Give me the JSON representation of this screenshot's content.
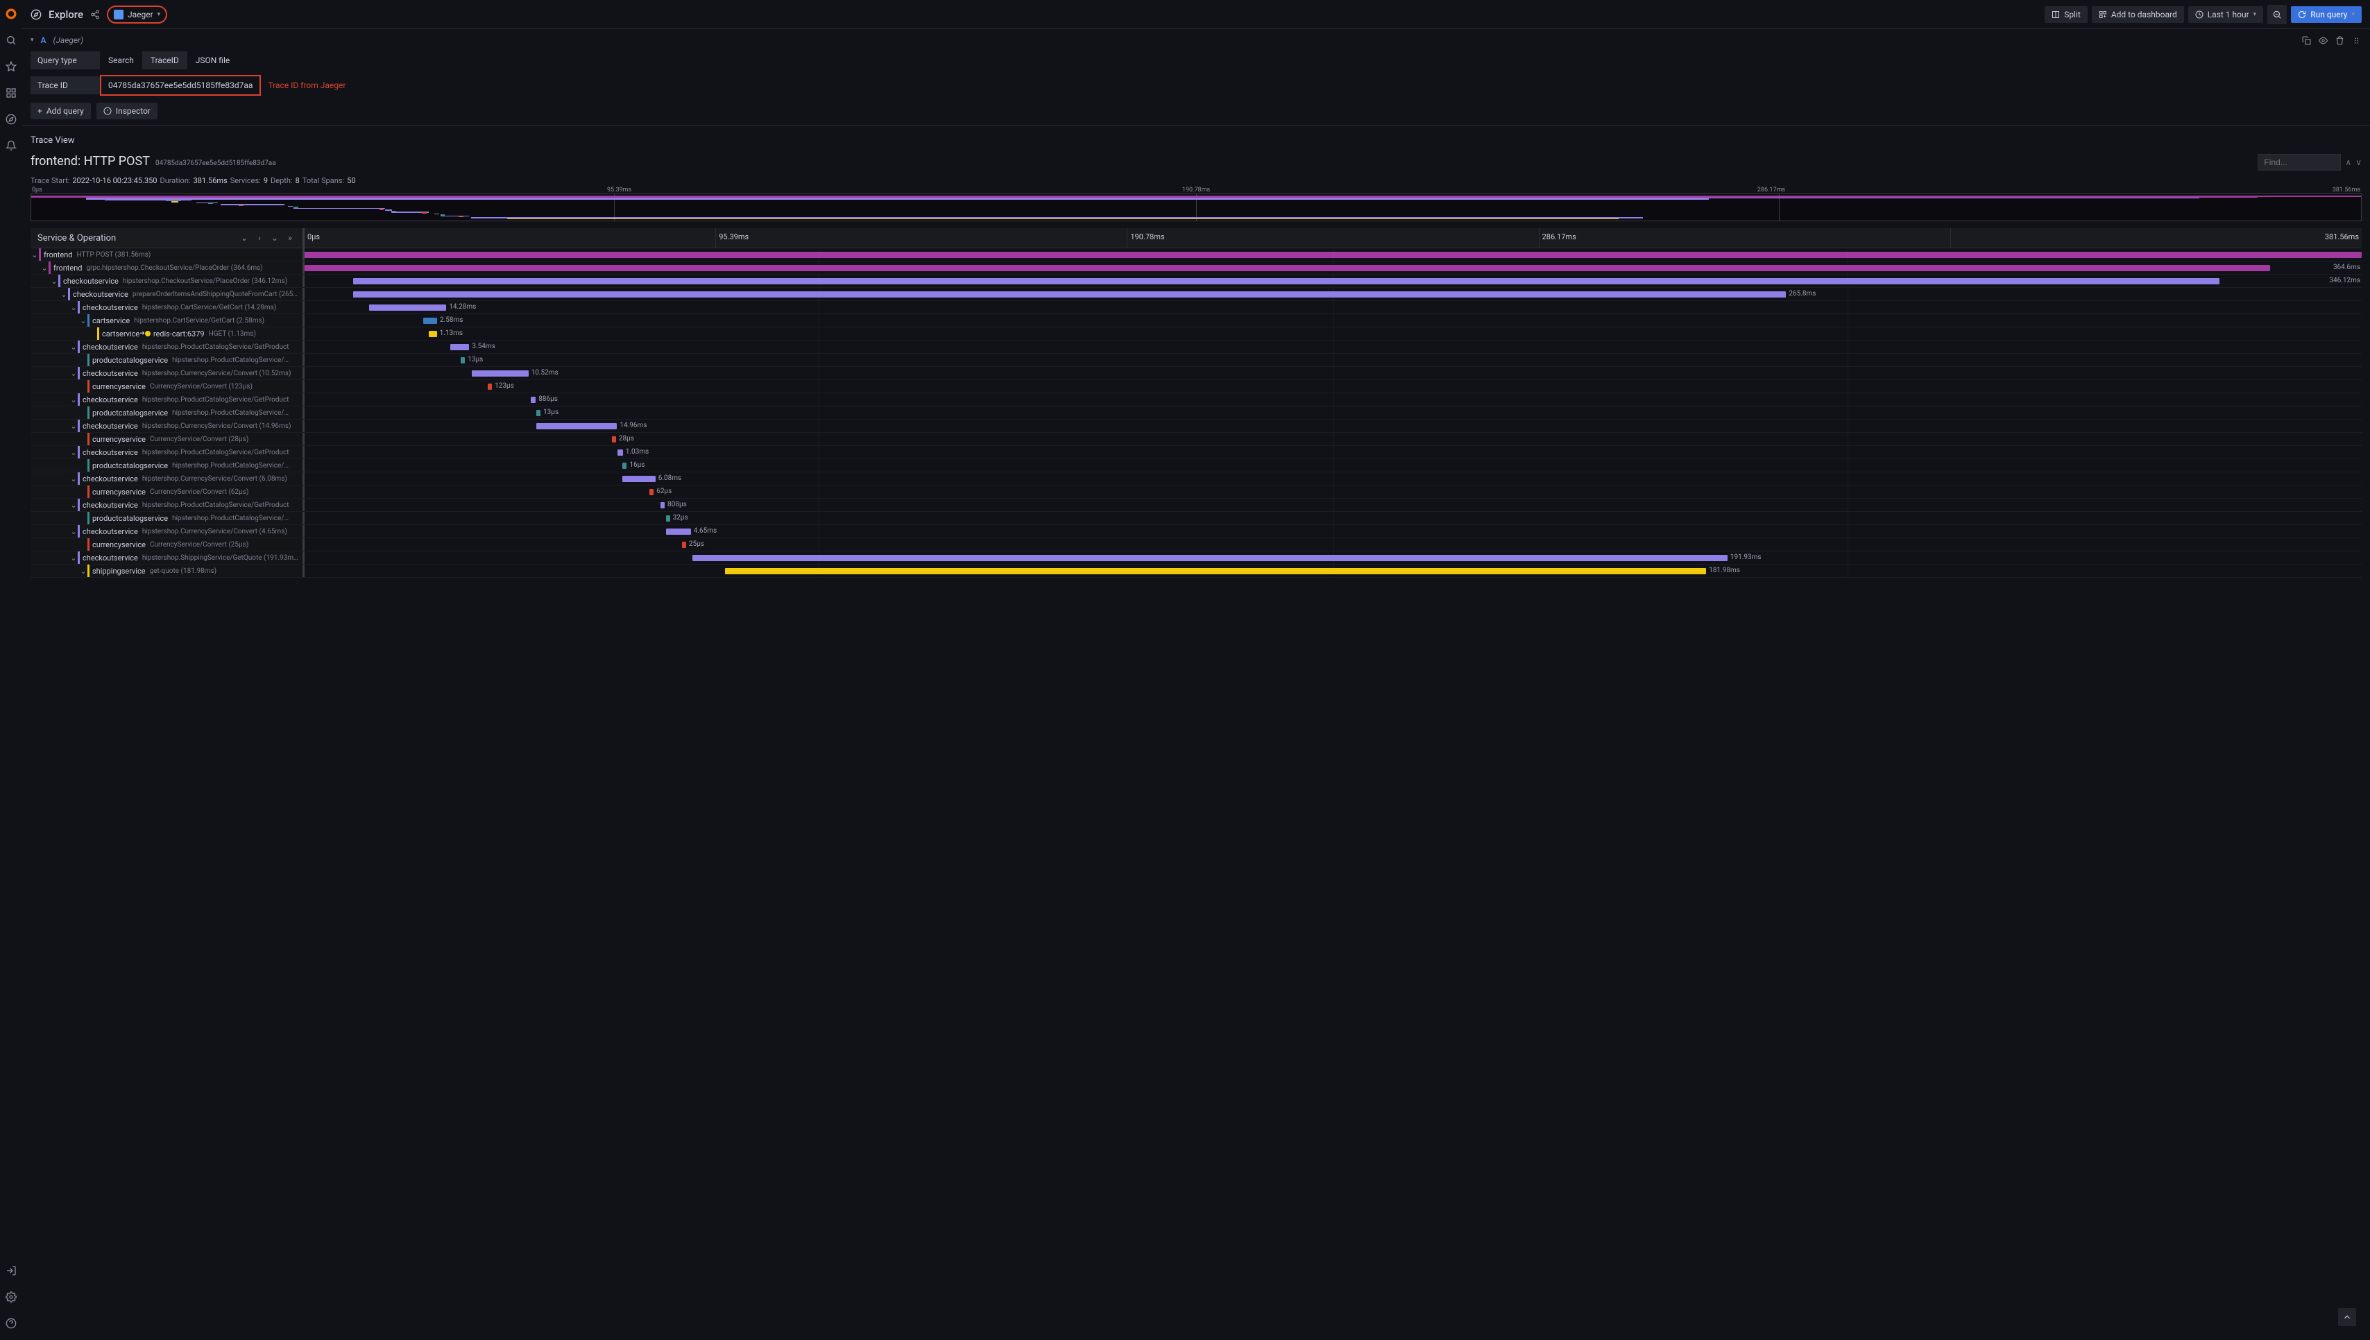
{
  "topbar": {
    "title": "Explore",
    "datasource": "Jaeger",
    "split": "Split",
    "add_dashboard": "Add to dashboard",
    "time_range": "Last 1 hour",
    "run_query": "Run query"
  },
  "query": {
    "letter": "A",
    "ds_label": "(Jaeger)",
    "type_label": "Query type",
    "tabs": [
      "Search",
      "TraceID",
      "JSON file"
    ],
    "trace_id_label": "Trace ID",
    "trace_id_value": "04785da37657ee5e5dd5185ffe83d7aa",
    "annotation": "Trace ID from Jaeger",
    "add_query": "Add query",
    "inspector": "Inspector"
  },
  "trace": {
    "view_title": "Trace View",
    "title_service": "frontend:",
    "title_op": "HTTP POST",
    "trace_id": "04785da37657ee5e5dd5185ffe83d7aa",
    "find_placeholder": "Find...",
    "meta": {
      "start_label": "Trace Start:",
      "start": "2022-10-16 00:23:45.350",
      "duration_label": "Duration:",
      "duration": "381.56ms",
      "services_label": "Services:",
      "services": "9",
      "depth_label": "Depth:",
      "depth": "8",
      "spans_label": "Total Spans:",
      "spans": "50"
    },
    "ticks": [
      "0µs",
      "95.39ms",
      "190.78ms",
      "286.17ms",
      "381.56ms"
    ],
    "so_title": "Service & Operation"
  },
  "chart_data": {
    "type": "gantt",
    "x_unit": "ms",
    "x_range": [
      0,
      381.56
    ],
    "colors": {
      "frontend": "#a23aa2",
      "checkoutservice": "#8f7fe6",
      "cartservice": "#3a7cc2",
      "redis": "#f2cc0c",
      "productcatalogservice": "#3c8c8c",
      "currencyservice": "#d9432c",
      "shippingservice": "#f2cc0c"
    },
    "spans": [
      {
        "depth": 0,
        "service": "frontend",
        "op": "HTTP POST (381.56ms)",
        "color": "frontend",
        "start": 0,
        "dur": 381.56,
        "label": ""
      },
      {
        "depth": 1,
        "service": "frontend",
        "op": "grpc.hipstershop.CheckoutService/PlaceOrder (364.6ms)",
        "color": "frontend",
        "start": 0,
        "dur": 364.6,
        "label": "364.6ms"
      },
      {
        "depth": 2,
        "service": "checkoutservice",
        "op": "hipstershop.CheckoutService/PlaceOrder (346.12ms)",
        "color": "checkoutservice",
        "start": 9,
        "dur": 346.12,
        "label": "346.12ms",
        "labelRight": true
      },
      {
        "depth": 3,
        "service": "checkoutservice",
        "op": "prepareOrderItemsAndShippingQuoteFromCart (265…",
        "color": "checkoutservice",
        "start": 9,
        "dur": 265.8,
        "label": "265.8ms"
      },
      {
        "depth": 4,
        "service": "checkoutservice",
        "op": "hipstershop.CartService/GetCart (14.28ms)",
        "color": "checkoutservice",
        "start": 12,
        "dur": 14.28,
        "label": "14.28ms"
      },
      {
        "depth": 5,
        "service": "cartservice",
        "op": "hipstershop.CartService/GetCart (2.58ms)",
        "color": "cartservice",
        "start": 22,
        "dur": 2.58,
        "label": "2.58ms"
      },
      {
        "depth": 6,
        "service": "cartservice",
        "arrow": true,
        "dot": true,
        "target": "redis-cart:6379",
        "op": "HGET (1.13ms)",
        "color": "redis",
        "start": 23,
        "dur": 1.13,
        "label": "1.13ms",
        "noChevron": true
      },
      {
        "depth": 4,
        "service": "checkoutservice",
        "op": "hipstershop.ProductCatalogService/GetProduct",
        "color": "checkoutservice",
        "start": 27,
        "dur": 3.54,
        "label": "3.54ms"
      },
      {
        "depth": 5,
        "service": "productcatalogservice",
        "op": "hipstershop.ProductCatalogService/…",
        "color": "productcatalogservice",
        "start": 29,
        "dur": 0.013,
        "label": "13µs",
        "noChevron": true,
        "thin": true
      },
      {
        "depth": 4,
        "service": "checkoutservice",
        "op": "hipstershop.CurrencyService/Convert (10.52ms)",
        "color": "checkoutservice",
        "start": 31,
        "dur": 10.52,
        "label": "10.52ms"
      },
      {
        "depth": 5,
        "service": "currencyservice",
        "op": "CurrencyService/Convert (123µs)",
        "color": "currencyservice",
        "start": 34,
        "dur": 0.123,
        "label": "123µs",
        "noChevron": true,
        "thin": true
      },
      {
        "depth": 4,
        "service": "checkoutservice",
        "op": "hipstershop.ProductCatalogService/GetProduct",
        "color": "checkoutservice",
        "start": 42,
        "dur": 0.886,
        "label": "886µs",
        "thin": true
      },
      {
        "depth": 5,
        "service": "productcatalogservice",
        "op": "hipstershop.ProductCatalogService/…",
        "color": "productcatalogservice",
        "start": 43,
        "dur": 0.013,
        "label": "13µs",
        "noChevron": true,
        "thin": true
      },
      {
        "depth": 4,
        "service": "checkoutservice",
        "op": "hipstershop.CurrencyService/Convert (14.96ms)",
        "color": "checkoutservice",
        "start": 43,
        "dur": 14.96,
        "label": "14.96ms"
      },
      {
        "depth": 5,
        "service": "currencyservice",
        "op": "CurrencyService/Convert (28µs)",
        "color": "currencyservice",
        "start": 57,
        "dur": 0.028,
        "label": "28µs",
        "noChevron": true,
        "thin": true
      },
      {
        "depth": 4,
        "service": "checkoutservice",
        "op": "hipstershop.ProductCatalogService/GetProduct",
        "color": "checkoutservice",
        "start": 58,
        "dur": 1.03,
        "label": "1.03ms",
        "thin": true
      },
      {
        "depth": 5,
        "service": "productcatalogservice",
        "op": "hipstershop.ProductCatalogService/…",
        "color": "productcatalogservice",
        "start": 59,
        "dur": 0.016,
        "label": "16µs",
        "noChevron": true,
        "thin": true
      },
      {
        "depth": 4,
        "service": "checkoutservice",
        "op": "hipstershop.CurrencyService/Convert (6.08ms)",
        "color": "checkoutservice",
        "start": 59,
        "dur": 6.08,
        "label": "6.08ms"
      },
      {
        "depth": 5,
        "service": "currencyservice",
        "op": "CurrencyService/Convert (62µs)",
        "color": "currencyservice",
        "start": 64,
        "dur": 0.062,
        "label": "62µs",
        "noChevron": true,
        "thin": true
      },
      {
        "depth": 4,
        "service": "checkoutservice",
        "op": "hipstershop.ProductCatalogService/GetProduct",
        "color": "checkoutservice",
        "start": 66,
        "dur": 0.808,
        "label": "808µs",
        "thin": true
      },
      {
        "depth": 5,
        "service": "productcatalogservice",
        "op": "hipstershop.ProductCatalogService/…",
        "color": "productcatalogservice",
        "start": 67,
        "dur": 0.032,
        "label": "32µs",
        "noChevron": true,
        "thin": true
      },
      {
        "depth": 4,
        "service": "checkoutservice",
        "op": "hipstershop.CurrencyService/Convert (4.65ms)",
        "color": "checkoutservice",
        "start": 67,
        "dur": 4.65,
        "label": "4.65ms"
      },
      {
        "depth": 5,
        "service": "currencyservice",
        "op": "CurrencyService/Convert (25µs)",
        "color": "currencyservice",
        "start": 70,
        "dur": 0.025,
        "label": "25µs",
        "noChevron": true,
        "thin": true
      },
      {
        "depth": 4,
        "service": "checkoutservice",
        "op": "hipstershop.ShippingService/GetQuote (191.93m…",
        "color": "checkoutservice",
        "start": 72,
        "dur": 191.93,
        "label": "191.93ms"
      },
      {
        "depth": 5,
        "service": "shippingservice",
        "op": "get-quote (181.98ms)",
        "color": "shippingservice",
        "start": 78,
        "dur": 181.98,
        "label": "181.98ms"
      }
    ]
  }
}
